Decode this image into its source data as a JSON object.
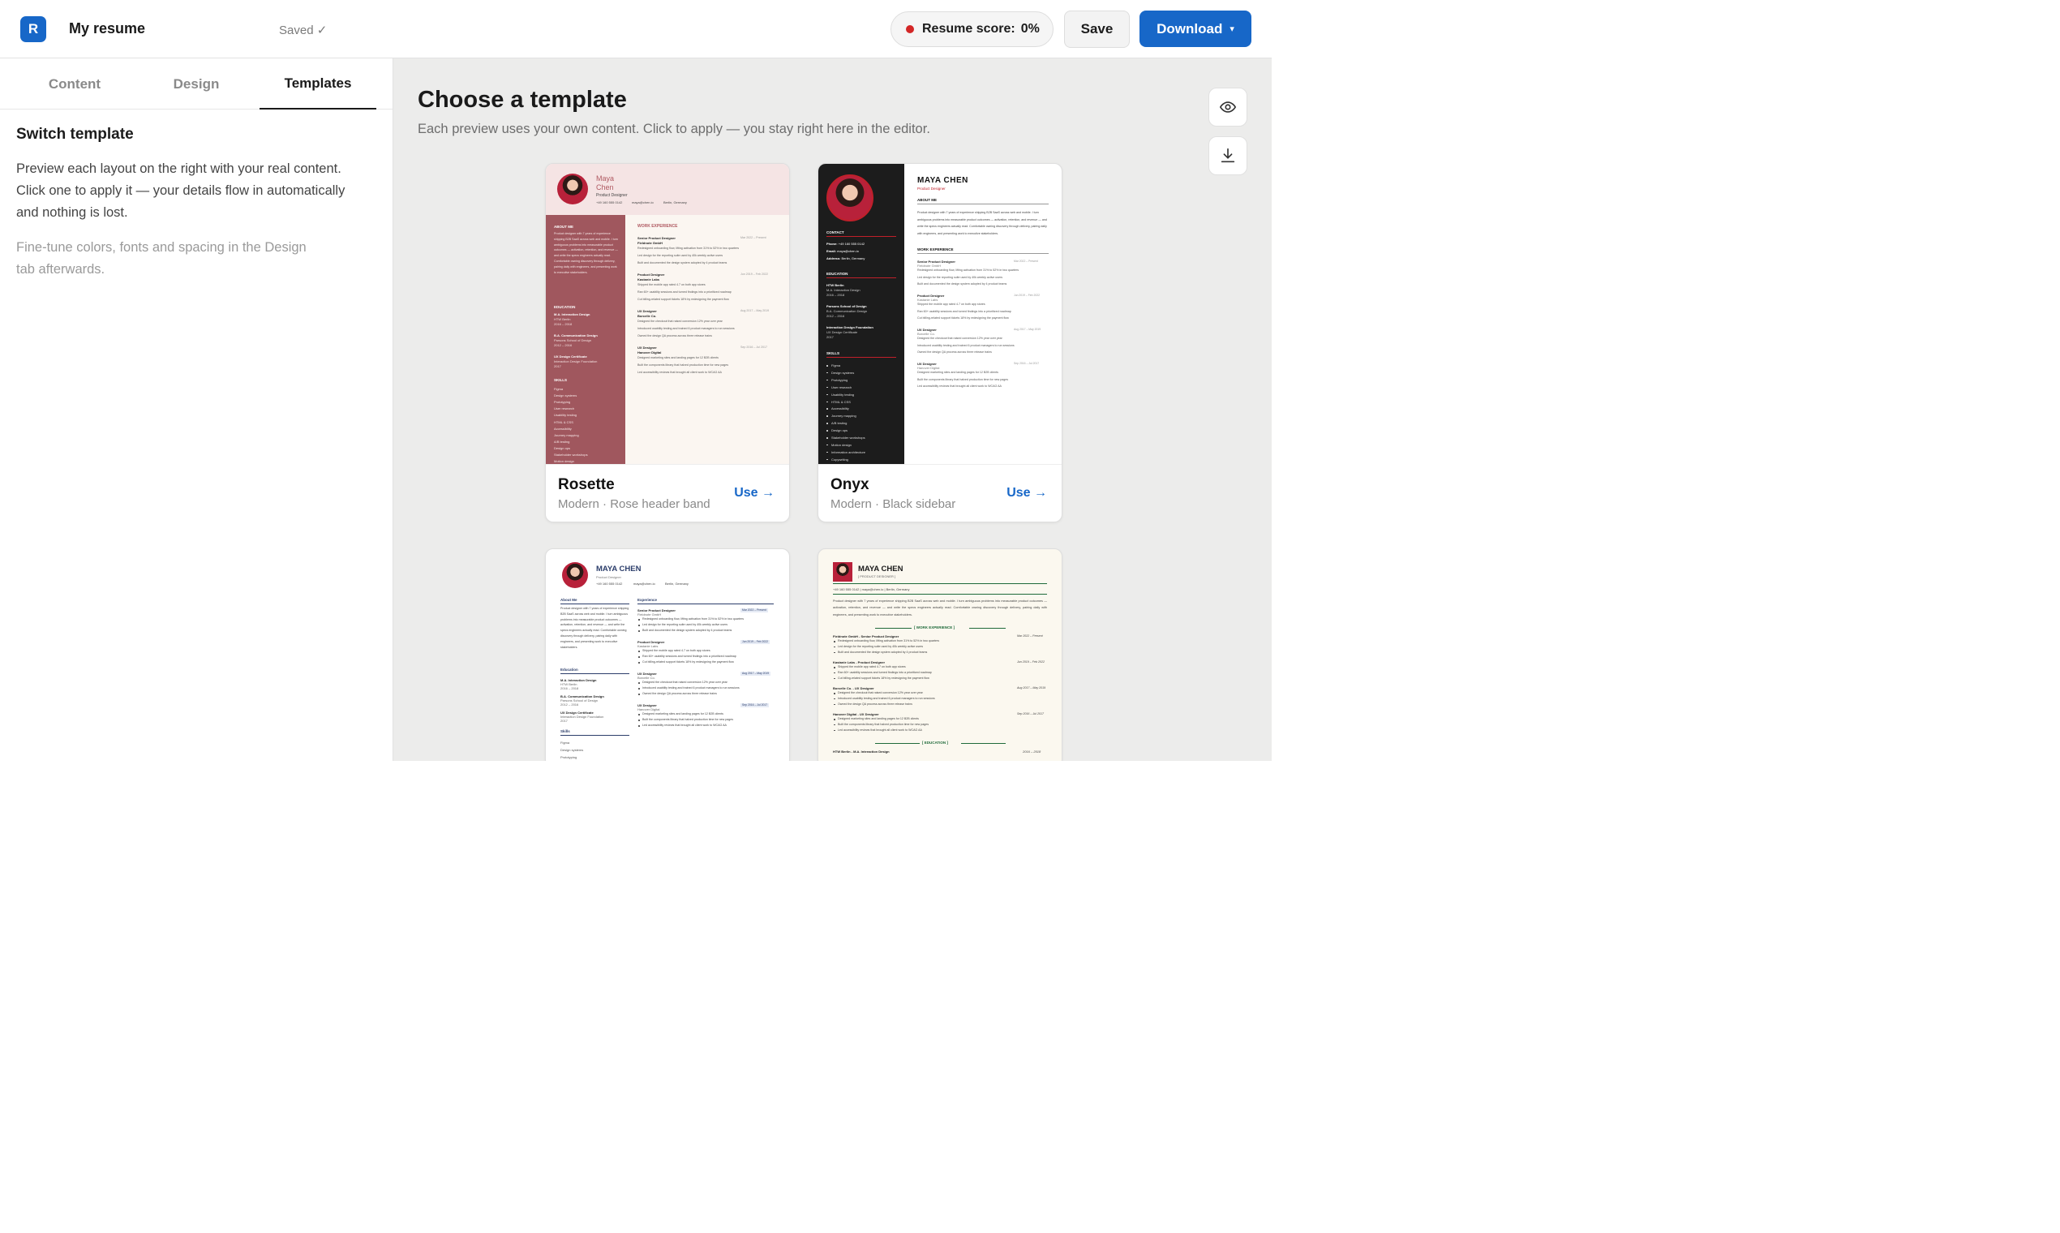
{
  "header": {
    "logo_letter": "R",
    "title": "My resume",
    "saved_status": "Saved ✓",
    "score_label": "Resume score:",
    "score_value": "0%",
    "save_label": "Save",
    "download_label": "Download",
    "download_caret": "▾",
    "score_color": "#d32626",
    "accent": "#1767c8"
  },
  "sidebar": {
    "tabs": [
      {
        "label": "Content"
      },
      {
        "label": "Design"
      },
      {
        "label": "Templates"
      }
    ],
    "active_tab": "Templates",
    "heading": "Switch template",
    "description": "Preview each layout on the right with your real content. Click one to apply it — your details flow in automatically and nothing is lost.",
    "note": "Fine-tune colors, fonts and spacing in the Design tab afterwards."
  },
  "main": {
    "title": "Choose a template",
    "subtitle": "Each preview uses your own content. Click to apply — you stay right here in the editor.",
    "preview_icon": "eye-icon",
    "download_icon": "download-icon"
  },
  "templates": [
    {
      "name": "Rosette",
      "style": "Modern",
      "description": "Rose header band",
      "use_label": "Use →"
    },
    {
      "name": "Onyx",
      "style": "Modern",
      "description": "Black sidebar",
      "use_label": "Use →"
    }
  ],
  "resume": {
    "first_name": "Maya",
    "last_name": "Chen",
    "full_name_caps": "MAYA CHEN",
    "role": "Product Designer",
    "role_caps": "[ PRODUCT DESIGNER ]",
    "phone": "+49 160 555 0142",
    "email": "maya@chen.io",
    "location": "Berlin, Germany",
    "contact_line": "+49 160 555 0142 | maya@chen.io | Berlin, Germany",
    "about_heading_caps": "ABOUT ME",
    "about_heading": "About Me",
    "about": "Product designer with 7 years of experience shipping B2B SaaS across web and mobile. I turn ambiguous problems into measurable product outcomes — activation, retention, and revenue — and write the specs engineers actually read. Comfortable owning discovery through delivery, pairing daily with engineers, and presenting work to executive stakeholders.",
    "work_heading_caps": "WORK EXPERIENCE",
    "work_heading_bracket": "[ WORK EXPERIENCE ]",
    "experience_heading": "Experience",
    "education_heading_caps": "EDUCATION",
    "education_heading_bracket": "[ EDUCATION ]",
    "education_heading": "Education",
    "skills_heading_caps": "SKILLS",
    "skills_heading": "Skills",
    "contact_heading": "CONTACT",
    "phone_label": "Phone:",
    "email_label": "Email:",
    "address_label": "Address:",
    "jobs": [
      {
        "title": "Senior Product Designer",
        "company": "Fieldnote GmbH",
        "dates": "Mar 2022 – Present",
        "bullets": [
          "Redesigned onboarding flow, lifting activation from 31% to 52% in two quarters",
          "Led design for the reporting suite used by 40k weekly active users",
          "Built and documented the design system adopted by 4 product teams"
        ]
      },
      {
        "title": "Product Designer",
        "company": "Kastanie Labs",
        "dates": "Jun 2019 – Feb 2022",
        "bullets": [
          "Shipped the mobile app rated 4.7 on both app stores",
          "Ran 60+ usability sessions and turned findings into a prioritized roadmap",
          "Cut billing-related support tickets 18% by redesigning the payment flow"
        ]
      },
      {
        "title": "UX Designer",
        "company": "Borcelle Co.",
        "dates": "Aug 2017 – May 2019",
        "bullets": [
          "Designed the checkout that raised conversion 12% year over year",
          "Introduced usability testing and trained 6 product managers to run sessions",
          "Owned the design QA process across three release trains"
        ]
      },
      {
        "title": "UX Designer",
        "company": "Hanover Digital",
        "dates": "Sep 2016 – Jul 2017",
        "bullets": [
          "Designed marketing sites and landing pages for 12 B2B clients",
          "Built the components library that halved production time for new pages",
          "Led accessibility reviews that brought all client work to WCAG AA"
        ]
      }
    ],
    "education": [
      {
        "degree": "M.A. Interaction Design",
        "school": "HTW Berlin",
        "years": "2016 – 2018"
      },
      {
        "degree": "B.A. Communication Design",
        "school": "Parsons School of Design",
        "years": "2012 – 2016"
      },
      {
        "degree": "UX Design Certificate",
        "school": "Interaction Design Foundation",
        "years": "2017"
      }
    ],
    "onyx_education": [
      {
        "degree": "HTW Berlin",
        "school": "M.A. Interaction Design",
        "years": "2016 – 2018"
      },
      {
        "degree": "Parsons School of Design",
        "school": "B.A. Communication Design",
        "years": "2012 – 2016"
      },
      {
        "degree": "Interaction Design Foundation",
        "school": "UX Design Certificate",
        "years": "2017"
      }
    ],
    "skills": [
      "Figma",
      "Design systems",
      "Prototyping",
      "User research",
      "Usability testing",
      "HTML & CSS",
      "Accessibility",
      "Journey mapping",
      "A/B testing",
      "Design ops",
      "Stakeholder workshops",
      "Motion design",
      "Information architecture",
      "Copywriting"
    ],
    "classic_jobs": [
      {
        "header": "Fieldnote GmbH - Senior Product Designer",
        "dates": "Mar 2022 – Present"
      },
      {
        "header": "Kastanie Labs - Product Designer",
        "dates": "Jun 2019 – Feb 2022"
      },
      {
        "header": "Borcelle Co. - UX Designer",
        "dates": "Aug 2017 – May 2019"
      },
      {
        "header": "Hanover Digital - UX Designer",
        "dates": "Sep 2016 – Jul 2017"
      }
    ],
    "classic_edu": {
      "header": "HTW Berlin - M.A. Interaction Design",
      "dates": "2016 – 2018"
    }
  },
  "colors": {
    "rose_band": "#f5e4e4",
    "rose_sidebar": "#a0575e",
    "rose_accent": "#b05a62",
    "onyx_sidebar": "#1c1c1c",
    "onyx_accent": "#c0202a",
    "navy_name": "#2c3e6b",
    "classic_bg": "#fbf8ef",
    "classic_rule": "#1f6a3a"
  }
}
